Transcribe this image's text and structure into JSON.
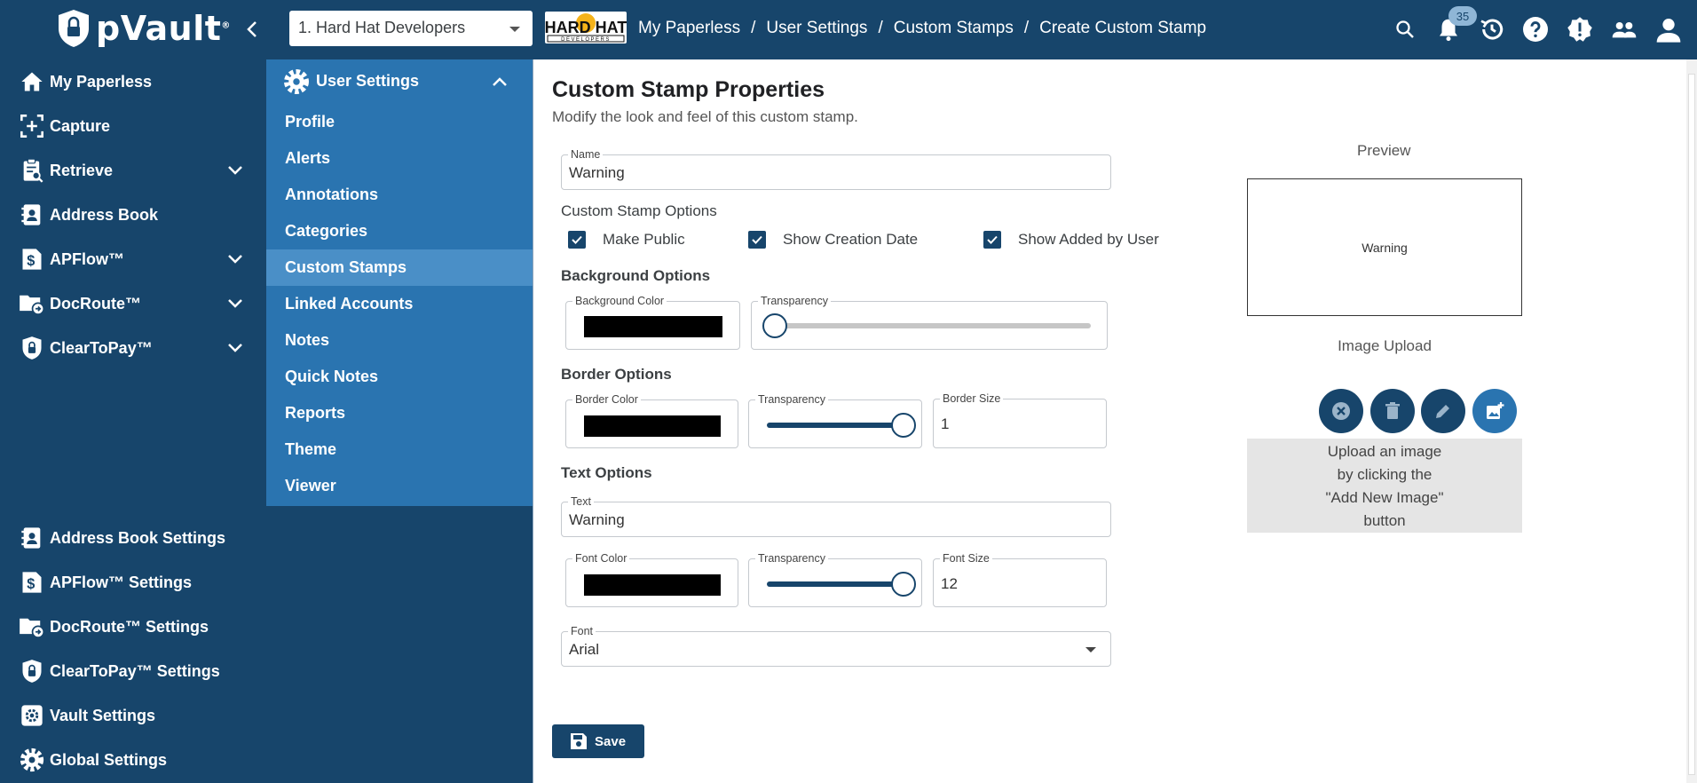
{
  "app": {
    "name": "pVault",
    "trademark": "®"
  },
  "vault_selector": {
    "value": "1. Hard Hat Developers"
  },
  "company_logo": {
    "line1": "HARD HAT",
    "line2": "DEVELOPERS"
  },
  "breadcrumb": [
    "My Paperless",
    "User Settings",
    "Custom Stamps",
    "Create Custom Stamp"
  ],
  "breadcrumb_sep": "/",
  "notifications": {
    "count": "35"
  },
  "nav": {
    "top": [
      {
        "label": "My Paperless",
        "icon": "home-icon"
      },
      {
        "label": "Capture",
        "icon": "capture-icon"
      },
      {
        "label": "Retrieve",
        "icon": "retrieve-icon"
      },
      {
        "label": "Address Book",
        "icon": "address-book-icon"
      },
      {
        "label": "APFlow™",
        "icon": "dollar-doc-icon"
      },
      {
        "label": "DocRoute™",
        "icon": "folder-route-icon"
      },
      {
        "label": "ClearToPay™",
        "icon": "shield-lock-icon"
      }
    ],
    "bottom": [
      {
        "label": "Address Book Settings"
      },
      {
        "label": "APFlow™ Settings"
      },
      {
        "label": "DocRoute™ Settings"
      },
      {
        "label": "ClearToPay™ Settings"
      },
      {
        "label": "Vault Settings"
      },
      {
        "label": "Global Settings"
      }
    ]
  },
  "subnav": {
    "title": "User Settings",
    "items": [
      "Profile",
      "Alerts",
      "Annotations",
      "Categories",
      "Custom Stamps",
      "Linked Accounts",
      "Notes",
      "Quick Notes",
      "Reports",
      "Theme",
      "Viewer"
    ],
    "active": "Custom Stamps"
  },
  "page": {
    "title": "Custom Stamp Properties",
    "subtitle": "Modify the look and feel of this custom stamp."
  },
  "form": {
    "name_label": "Name",
    "name_value": "Warning",
    "options_label": "Custom Stamp Options",
    "make_public": "Make Public",
    "show_creation_date": "Show Creation Date",
    "show_added_by_user": "Show Added by User",
    "background_head": "Background Options",
    "background_color_label": "Background Color",
    "transparency_label": "Transparency",
    "background_transparency": 0,
    "border_head": "Border Options",
    "border_color_label": "Border Color",
    "border_transparency": 100,
    "border_size_label": "Border Size",
    "border_size_value": "1",
    "text_head": "Text Options",
    "text_label": "Text",
    "text_value": "Warning",
    "font_color_label": "Font Color",
    "font_transparency": 100,
    "font_size_label": "Font Size",
    "font_size_value": "12",
    "font_label": "Font",
    "font_value": "Arial",
    "save": "Save"
  },
  "preview": {
    "label": "Preview",
    "text": "Warning",
    "upload_label": "Image Upload",
    "upload_line1": "Upload an image",
    "upload_line2": "by clicking the",
    "upload_line3": "\"Add New Image\"",
    "upload_line4": "button"
  },
  "colors": {
    "primary": "#17456b",
    "secondary": "#2a74b0",
    "active": "#4a8fc7",
    "swatch": "#000000"
  }
}
